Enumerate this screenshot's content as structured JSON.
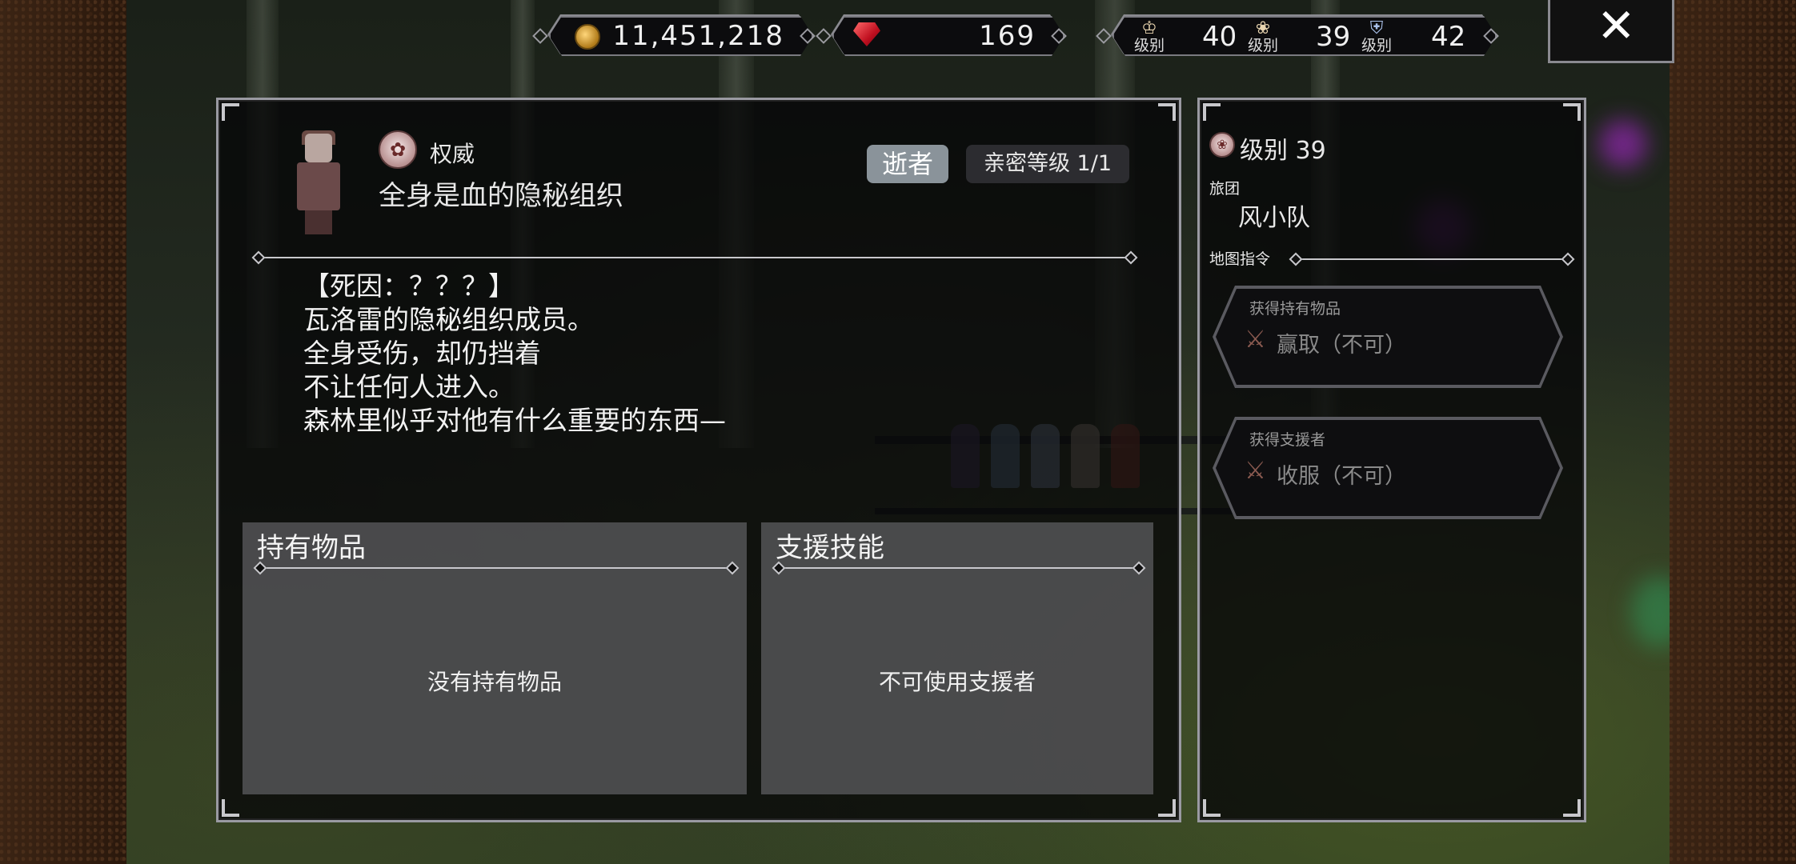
{
  "currencies": {
    "money": "11,451,218",
    "gems": "169",
    "ranks": [
      {
        "label": "级别",
        "value": "40",
        "icon": "crown-icon"
      },
      {
        "label": "级别",
        "value": "39",
        "icon": "rose-icon"
      },
      {
        "label": "级别",
        "value": "42",
        "icon": "shield-icon"
      }
    ]
  },
  "character": {
    "ring": "权威",
    "name": "全身是血的隐秘组织",
    "status_tag": "逝者",
    "affinity": "亲密等级 1/1",
    "description": [
      "【死因：？？？】",
      "瓦洛雷的隐秘组织成员。",
      "全身受伤，却仍挡着",
      "不让任何人进入。",
      "森林里似乎对他有什么重要的东西—"
    ],
    "items_title": "持有物品",
    "items_empty": "没有持有物品",
    "support_title": "支援技能",
    "support_empty": "不可使用支援者"
  },
  "side_panel": {
    "level": "级别 39",
    "guild_label": "旅团",
    "guild_name": "风小队",
    "map_cmd_label": "地图指令",
    "commands": [
      {
        "caption": "获得持有物品",
        "action": "赢取（不可）"
      },
      {
        "caption": "获得支援者",
        "action": "收服（不可）"
      }
    ]
  },
  "colors": {
    "panel_border": "#9a9aa2",
    "tag_dead": "#8a939a",
    "subbox": "#5a5a5c"
  }
}
